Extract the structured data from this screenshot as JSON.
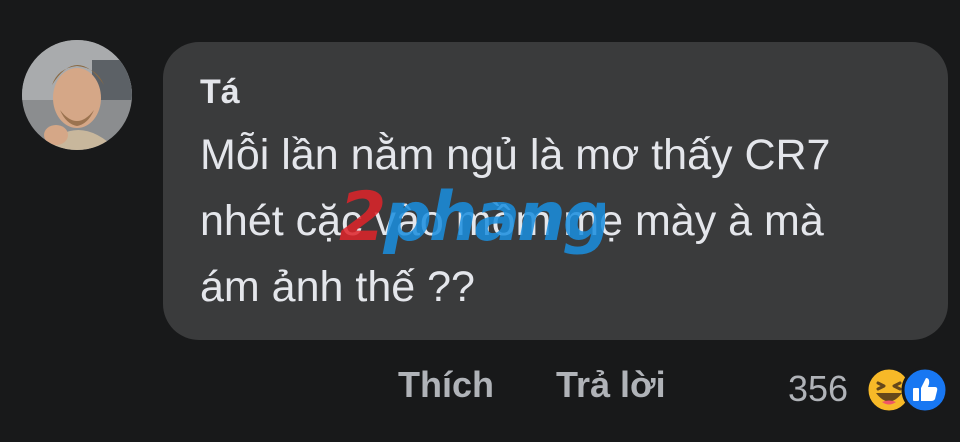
{
  "comment": {
    "author": "Tá",
    "text": "Mỗi lần nằm ngủ là mơ thấy CR7\nnhét cặc vào mồm mẹ mày à mà\nám ảnh thế ??"
  },
  "watermark": {
    "text": "2phang",
    "colors": {
      "accent": "#e0242a",
      "primary": "#1a8fe0"
    }
  },
  "actions": {
    "like_label": "Thích",
    "reply_label": "Trả lời"
  },
  "reactions": {
    "count": "356",
    "icons": [
      "haha-icon",
      "like-icon"
    ]
  },
  "colors": {
    "background": "#18191a",
    "bubble": "#3a3b3c",
    "text": "#e4e6eb",
    "secondary_text": "#b0b3b8",
    "like_blue": "#1877f2",
    "haha_yellow": "#f7b928"
  }
}
